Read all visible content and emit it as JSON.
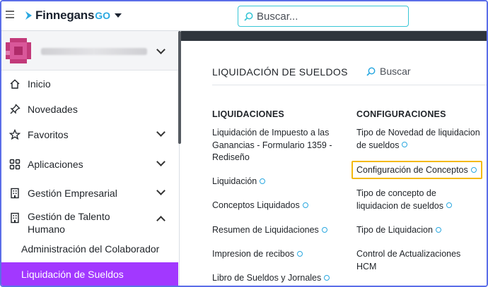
{
  "header": {
    "logo_text": "Finnegans",
    "logo_suffix": "GO",
    "search_placeholder": "Buscar..."
  },
  "sidebar": {
    "items": [
      {
        "label": "Inicio",
        "icon": "home-icon"
      },
      {
        "label": "Novedades",
        "icon": "pin-icon"
      },
      {
        "label": "Favoritos",
        "icon": "star-icon",
        "chevron": "down"
      },
      {
        "label": "Aplicaciones",
        "icon": "grid-icon",
        "chevron": "down"
      },
      {
        "label": "Gestión Empresarial",
        "icon": "building-icon",
        "chevron": "down"
      },
      {
        "label": "Gestión de Talento Humano",
        "icon": "building-icon",
        "chevron": "up"
      }
    ],
    "sub_items": [
      {
        "label": "Administración del Colaborador",
        "active": false
      },
      {
        "label": "Liquidación de Sueldos",
        "active": true
      }
    ]
  },
  "main": {
    "section_title": "LIQUIDACIÓN DE SUELDOS",
    "search_label": "Buscar",
    "columns": [
      {
        "title": "LIQUIDACIONES",
        "links": [
          {
            "label": "Liquidación de Impuesto a las Ganancias - Formulario 1359 - Rediseño",
            "info": false
          },
          {
            "label": "Liquidación",
            "info": true
          },
          {
            "label": "Conceptos Liquidados",
            "info": true
          },
          {
            "label": "Resumen de Liquidaciones",
            "info": true
          },
          {
            "label": "Impresion de recibos",
            "info": true
          },
          {
            "label": "Libro de Sueldos y Jornales",
            "info": true
          }
        ]
      },
      {
        "title": "CONFIGURACIONES",
        "links": [
          {
            "label": "Tipo de Novedad de liquidacion de sueldos",
            "info": true
          },
          {
            "label": "Configuración de Conceptos",
            "info": true,
            "highlighted": true
          },
          {
            "label": "Tipo de concepto de liquidacion de sueldos",
            "info": true
          },
          {
            "label": "Tipo de Liquidacion",
            "info": true
          },
          {
            "label": "Control de Actualizaciones HCM",
            "info": false
          }
        ]
      }
    ]
  },
  "colors": {
    "accent_purple": "#a238ff",
    "highlight": "#f3b90f",
    "info_blue": "#2aa8e0",
    "search_border": "#38c6d6"
  }
}
